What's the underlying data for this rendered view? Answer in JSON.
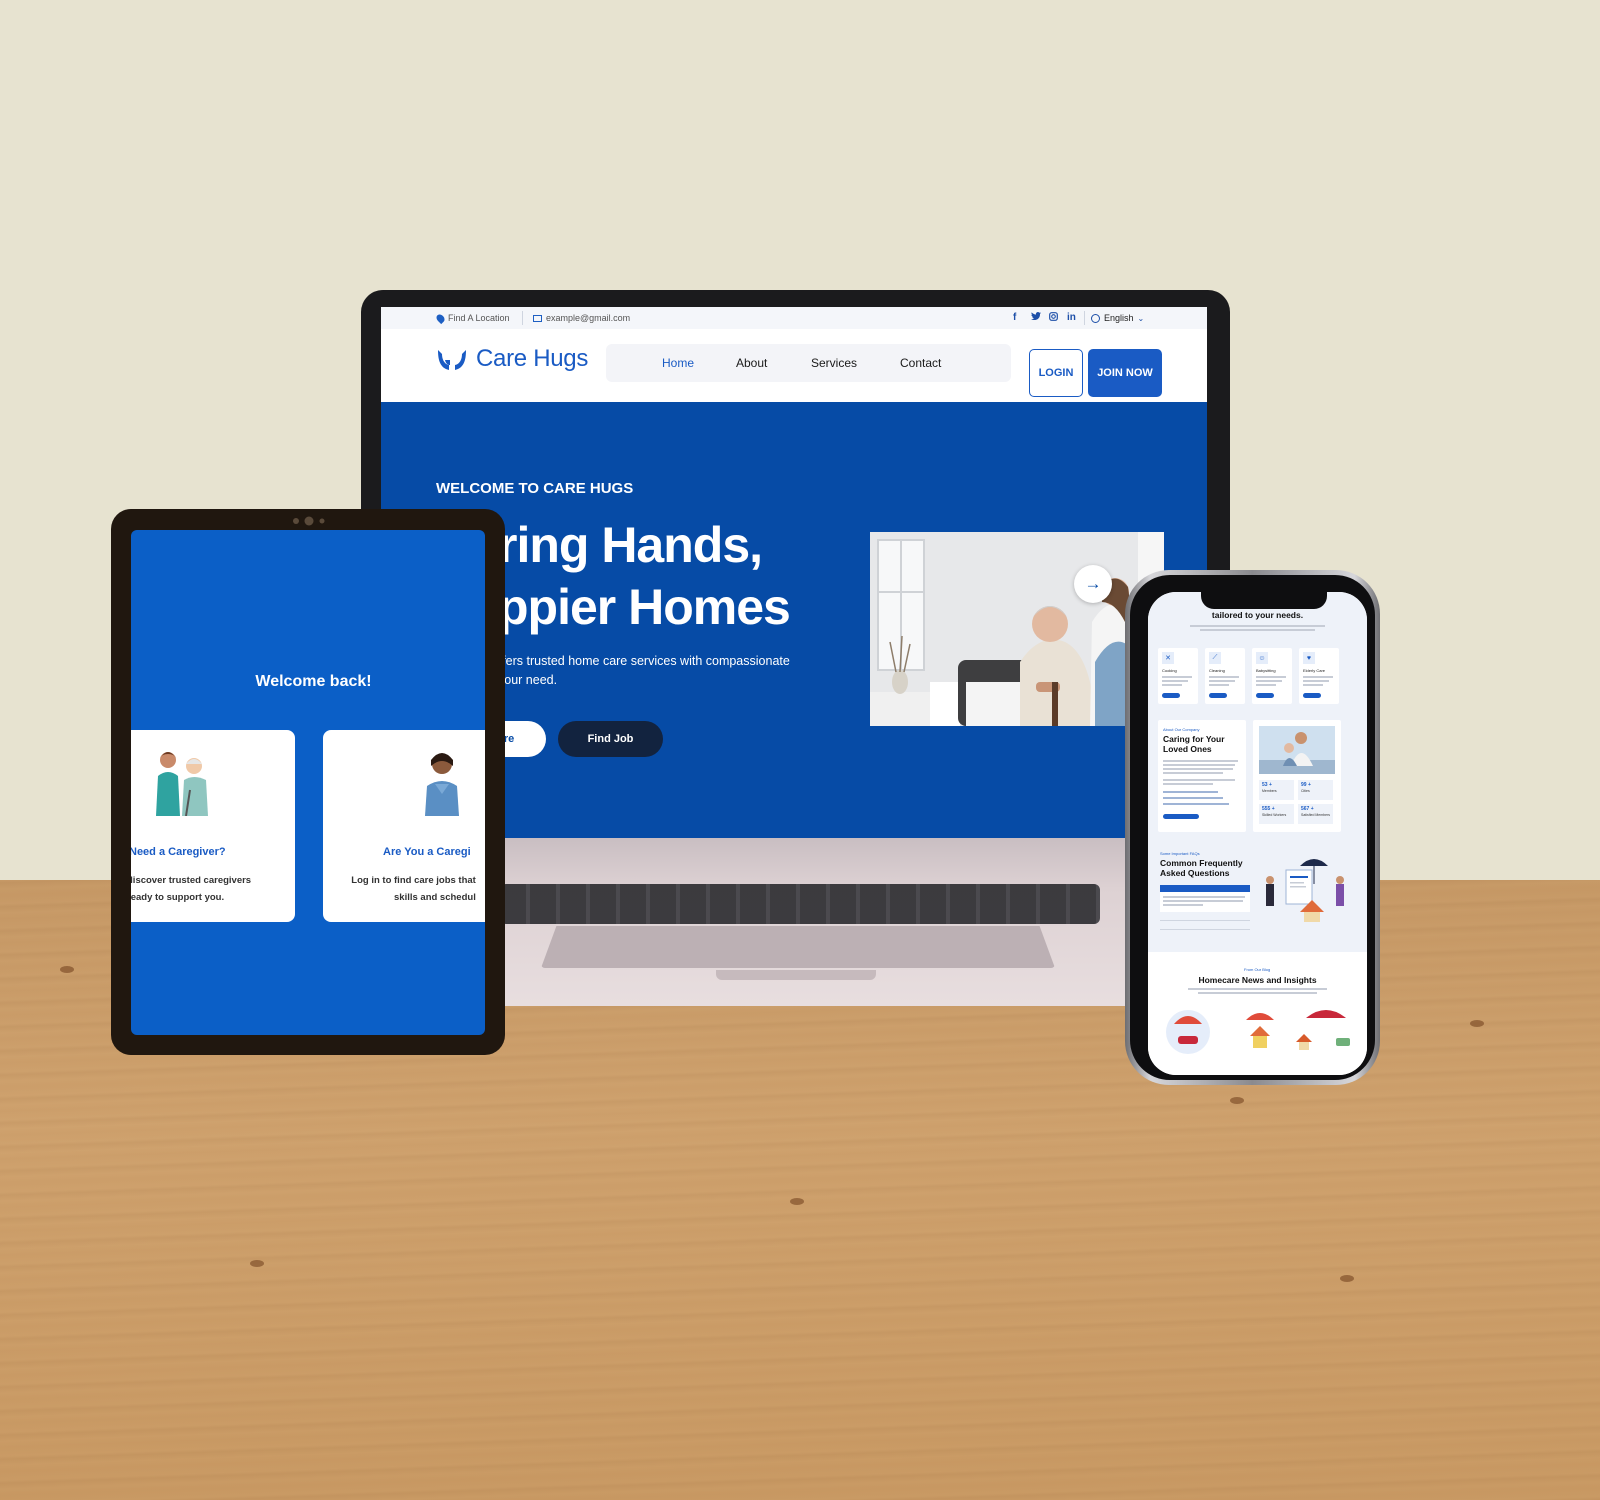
{
  "laptop": {
    "topbar": {
      "location": "Find A Location",
      "email": "example@gmail.com",
      "social": [
        "f",
        "t",
        "ig",
        "in"
      ],
      "language": "English"
    },
    "nav": {
      "brand": "Care Hugs",
      "menu": [
        "Home",
        "About",
        "Services",
        "Contact"
      ],
      "active": "Home",
      "login": "LOGIN",
      "join": "JOIN NOW"
    },
    "hero": {
      "kicker": "WELCOME TO CARE HUGS",
      "title_line1": "ring Hands,",
      "title_line2": "ppier Homes",
      "desc_line1": "offers trusted home care services with compassionate",
      "desc_line2": "your need.",
      "btn_care": "are",
      "btn_job": "Find Job",
      "arrow": "→"
    }
  },
  "tablet": {
    "title": "Welcome back!",
    "card1": {
      "title": "Need a Caregiver?",
      "line1": "discover trusted caregivers",
      "line2": "ready to support you."
    },
    "card2": {
      "title": "Are You a Caregi",
      "line1": "Log in to find care jobs that",
      "line2": "skills and schedul"
    }
  },
  "phone": {
    "services_heading": "tailored to your needs.",
    "services": [
      "Cooking",
      "Cleaning",
      "Babysitting",
      "Elderly Care"
    ],
    "about": {
      "kicker": "About Our Company",
      "title_line1": "Caring for Your",
      "title_line2": "Loved Ones"
    },
    "stats": [
      {
        "value": "53 +",
        "label": "Members"
      },
      {
        "value": "99 +",
        "label": "Cities"
      },
      {
        "value": "555 +",
        "label": "Skilled Workers"
      },
      {
        "value": "567 +",
        "label": "Satisfied Members"
      }
    ],
    "faq": {
      "kicker": "Some Important FAQs",
      "title_line1": "Common Frequently",
      "title_line2": "Asked Questions"
    },
    "news": {
      "kicker": "From Our Blog",
      "title": "Homecare News and Insights"
    }
  },
  "colors": {
    "brand_blue": "#1a5bc4",
    "hero_blue": "#064ba6",
    "dark_navy": "#12233f",
    "tablet_blue": "#0b5fc7"
  }
}
